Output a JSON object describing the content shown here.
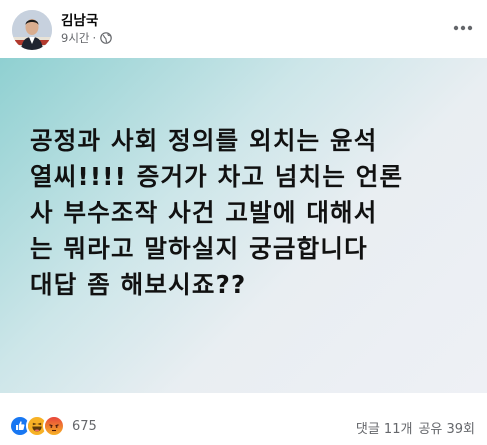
{
  "post": {
    "author": "김남국",
    "time": "9시간",
    "separator": "·",
    "audience_icon": "globe-icon",
    "more_icon": "more-options-icon",
    "text": "공정과 사회 정의를 외치는 윤석\n열씨!!!! 증거가 차고 넘치는 언론\n사 부수조작 사건 고발에 대해서\n는 뭐라고 말하실지 궁금합니다\n대답 좀 해보시죠??"
  },
  "footer": {
    "reaction_icons": [
      "like-icon",
      "haha-icon",
      "angry-icon"
    ],
    "reaction_count": "675",
    "comments": "댓글 11개",
    "shares": "공유 39회"
  },
  "colors": {
    "like": "#1877f2",
    "haha": "#f7b125",
    "angry": "#e8453c",
    "gradient_start": "#8fd0d1",
    "gradient_end": "#eef0f5",
    "secondary_text": "#65676b"
  }
}
